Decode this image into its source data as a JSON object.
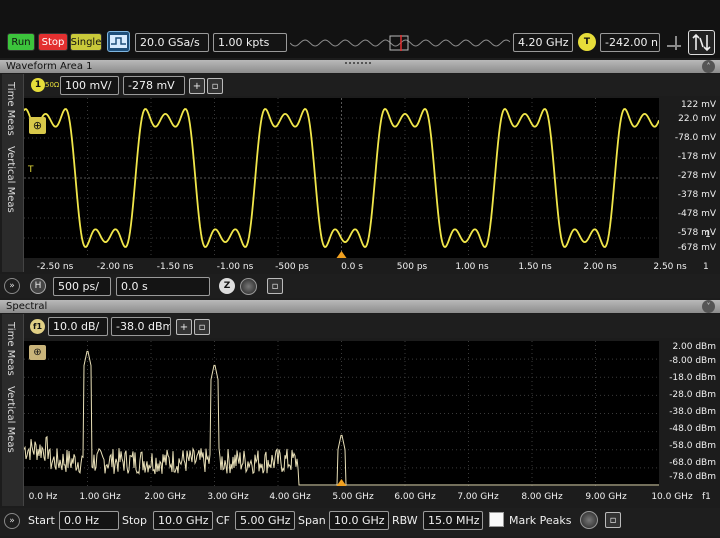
{
  "toolbar": {
    "run_label": "Run",
    "stop_label": "Stop",
    "single_label": "Single",
    "sample_rate": "20.0 GSa/s",
    "record_length": "1.00 kpts",
    "frequency": "4.20 GHz",
    "trigger_badge": "T",
    "trigger_level": "-242.00 n"
  },
  "waveform": {
    "title": "Waveform Area 1",
    "side_tabs": [
      "Time Meas",
      "Vertical Meas"
    ],
    "channel_badge": "1",
    "channel_ohm": "50Ω",
    "vscale": "100 mV/",
    "voffset": "-278 mV",
    "trigger_marker": "T",
    "y_labels": [
      "122 mV",
      "22.0 mV",
      "-78.0 mV",
      "-178 mV",
      "-278 mV",
      "-378 mV",
      "-478 mV",
      "-578 mV",
      "-678 mV"
    ],
    "right_marker": "1",
    "x_labels": [
      "-2.50 ns",
      "-2.00 ns",
      "-1.50 ns",
      "-1.00 ns",
      "-500 ps",
      "0.0 s",
      "500 ps",
      "1.00 ns",
      "1.50 ns",
      "2.00 ns",
      "2.50 ns"
    ],
    "x_unit": "1",
    "h_badge": "H",
    "hscale": "500 ps/",
    "hoffset": "0.0 s",
    "color": "#f0e64a"
  },
  "spectral": {
    "title": "Spectral",
    "side_tabs": [
      "Time Meas",
      "Vertical Meas"
    ],
    "channel_badge": "f1",
    "vscale": "10.0 dB/",
    "voffset": "-38.0 dBm",
    "y_labels": [
      "2.00 dBm",
      "-8.00 dBm",
      "-18.0 dBm",
      "-28.0 dBm",
      "-38.0 dBm",
      "-48.0 dBm",
      "-58.0 dBm",
      "-68.0 dBm",
      "-78.0 dBm"
    ],
    "x_labels": [
      "0.0 Hz",
      "1.00 GHz",
      "2.00 GHz",
      "3.00 GHz",
      "4.00 GHz",
      "5.00 GHz",
      "6.00 GHz",
      "7.00 GHz",
      "8.00 GHz",
      "9.00 GHz",
      "10.0 GHz"
    ],
    "x_unit": "f1",
    "start_label": "Start",
    "start_value": "0.0 Hz",
    "stop_label": "Stop",
    "stop_value": "10.0 GHz",
    "cf_label": "CF",
    "cf_value": "5.00 GHz",
    "span_label": "Span",
    "span_value": "10.0 GHz",
    "rbw_label": "RBW",
    "rbw_value": "15.0 MHz",
    "mark_peaks_label": "Mark Peaks",
    "color": "#e9e0b8"
  },
  "icons": {
    "waveform_pin": "⊕",
    "spectral_pin": "⊕",
    "plus": "+",
    "note": "▫"
  }
}
